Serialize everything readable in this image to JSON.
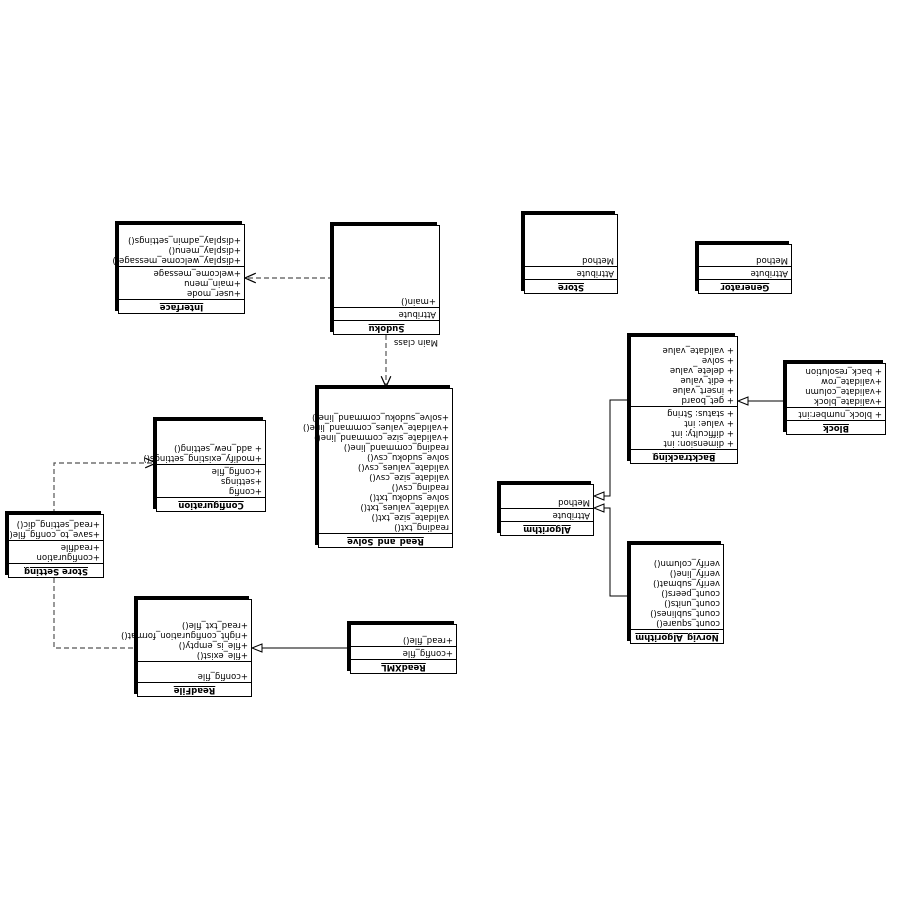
{
  "classes": {
    "sudoku": {
      "name": "Sudoku",
      "attributes": [
        "Attribute"
      ],
      "operations": [
        "+main()"
      ],
      "note": "Main class"
    },
    "interface": {
      "name": "Interface",
      "attributes": [
        "+user_mode",
        "+main_menu",
        "+welcome_message"
      ],
      "operations": [
        "+display_welcome_message()",
        "+display_menu()",
        "+display_admin_settings()"
      ]
    },
    "store": {
      "name": "Store",
      "attributes": [
        "Attribute"
      ],
      "operations": [
        "Method"
      ]
    },
    "generator": {
      "name": "Generator",
      "attributes": [
        "Attribute"
      ],
      "operations": [
        "Method"
      ]
    },
    "read_and_solve": {
      "name": "Read_and_Solve",
      "attributes": [],
      "operations": [
        "reading_txt()",
        "validate_size_txt()",
        "validate_values_txt()",
        "solve_sudoku_txt()",
        "reading_csv()",
        "validate_size_csv()",
        "validate_values_csv()",
        "solve_sudoku_csv()",
        "reading_command_line()",
        "+validate_size_command_line()",
        "+validate_values_command_line()",
        "+solve_sudoku_command_line()"
      ]
    },
    "backtracking": {
      "name": "Backtracking",
      "attributes": [
        "+ dimension: int",
        "+ difficulty: int",
        "+ value: int",
        "+ status: String"
      ],
      "operations": [
        "+ get_board",
        "+ insert_value",
        "+ edit_value",
        "+ delete_value",
        "+ solve",
        "+ validate_value"
      ]
    },
    "block": {
      "name": "Block",
      "attributes": [
        "+ block_number:int"
      ],
      "operations": [
        "+validate_block",
        "+validate_column",
        "+validate_row",
        "+ back_resolution"
      ]
    },
    "configuration": {
      "name": "Configuration",
      "attributes": [
        "+config",
        "+settings",
        "+config_file"
      ],
      "operations": [
        "+modify_existing_settings()",
        "+ add_new_setting()"
      ]
    },
    "algorithm": {
      "name": "Algorithm",
      "attributes": [
        "Attribute"
      ],
      "operations": [
        "Method"
      ]
    },
    "store_setting": {
      "name": "Store Setting",
      "attributes": [
        "+configuration",
        "+readfile"
      ],
      "operations": [
        "+save_to_config_file()",
        "+read_setting_dic()"
      ]
    },
    "norvig_algorithm": {
      "name": "Norvig_Algorithm",
      "attributes": [],
      "operations": [
        "count_square()",
        "count_sublines()",
        "count_units()",
        "count_peers()",
        "verify_submat()",
        "verify_line()",
        "verify_column()"
      ]
    },
    "readfile": {
      "name": "ReadFile",
      "attributes": [
        "+config_file"
      ],
      "operations": [
        "+file_exist()",
        "+file_is_empty()",
        "+right_configuration_format()",
        "+read_txt_file()"
      ]
    },
    "readxml": {
      "name": "ReadXML",
      "attributes": [
        "+config_file"
      ],
      "operations": [
        "+read_file()"
      ]
    }
  }
}
